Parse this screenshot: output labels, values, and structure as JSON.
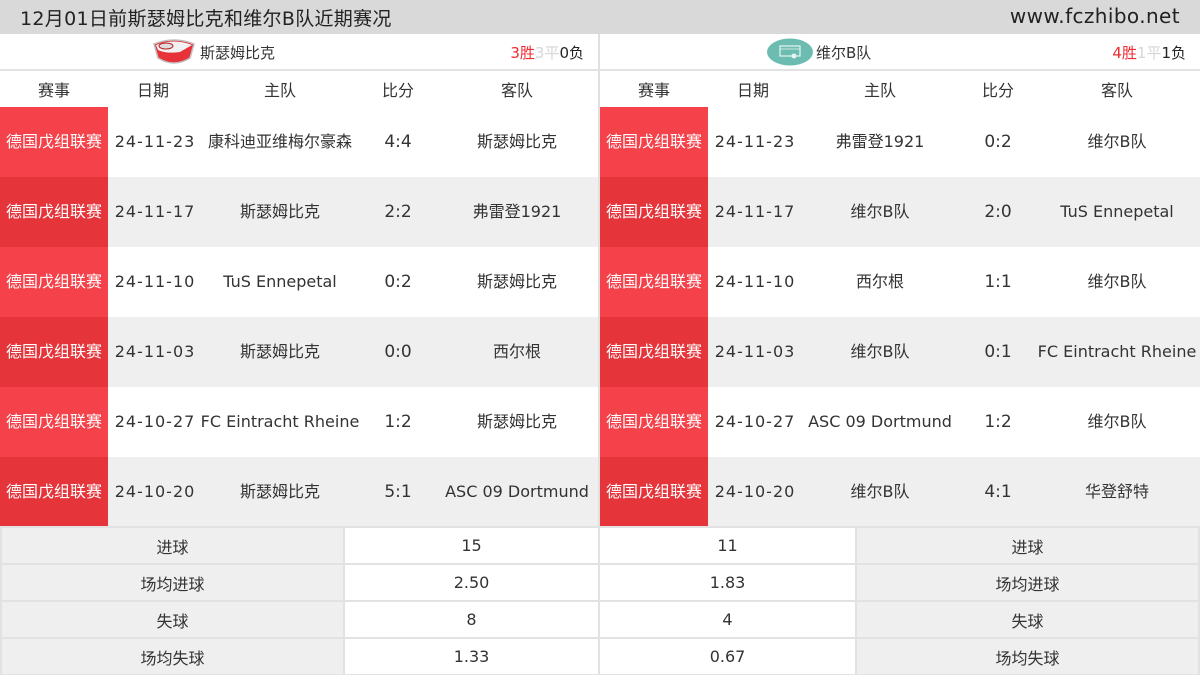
{
  "header": {
    "title": "12月01日前斯瑟姆比克和维尔B队近期赛况",
    "site": "www.fczhibo.net"
  },
  "columns": [
    "赛事",
    "日期",
    "主队",
    "比分",
    "客队"
  ],
  "colors": {
    "accent_red": "#ee2c33",
    "league_odd": "#f5414a",
    "league_even": "#e5343a",
    "row_even_bg": "#efefef",
    "topbar_bg": "#d9d9d9"
  },
  "left": {
    "team": "斯瑟姆比克",
    "logo_icon": "red-white-shield-crest",
    "record": {
      "win": "3胜",
      "draw": "3平",
      "loss": "0负"
    },
    "matches": [
      {
        "league": "德国戊组联赛",
        "date": "24-11-23",
        "home": "康科迪亚维梅尔豪森",
        "score": "4:4",
        "away": "斯瑟姆比克"
      },
      {
        "league": "德国戊组联赛",
        "date": "24-11-17",
        "home": "斯瑟姆比克",
        "score": "2:2",
        "away": "弗雷登1921"
      },
      {
        "league": "德国戊组联赛",
        "date": "24-11-10",
        "home": "TuS Ennepetal",
        "score": "0:2",
        "away": "斯瑟姆比克"
      },
      {
        "league": "德国戊组联赛",
        "date": "24-11-03",
        "home": "斯瑟姆比克",
        "score": "0:0",
        "away": "西尔根"
      },
      {
        "league": "德国戊组联赛",
        "date": "24-10-27",
        "home": "FC Eintracht Rheine",
        "score": "1:2",
        "away": "斯瑟姆比克"
      },
      {
        "league": "德国戊组联赛",
        "date": "24-10-20",
        "home": "斯瑟姆比克",
        "score": "5:1",
        "away": "ASC 09 Dortmund"
      }
    ],
    "stats": [
      {
        "label": "进球",
        "value": "15"
      },
      {
        "label": "场均进球",
        "value": "2.50"
      },
      {
        "label": "失球",
        "value": "8"
      },
      {
        "label": "场均失球",
        "value": "1.33"
      }
    ]
  },
  "right": {
    "team": "维尔B队",
    "logo_icon": "teal-placeholder-badge",
    "record": {
      "win": "4胜",
      "draw": "1平",
      "loss": "1负"
    },
    "matches": [
      {
        "league": "德国戊组联赛",
        "date": "24-11-23",
        "home": "弗雷登1921",
        "score": "0:2",
        "away": "维尔B队"
      },
      {
        "league": "德国戊组联赛",
        "date": "24-11-17",
        "home": "维尔B队",
        "score": "2:0",
        "away": "TuS Ennepetal"
      },
      {
        "league": "德国戊组联赛",
        "date": "24-11-10",
        "home": "西尔根",
        "score": "1:1",
        "away": "维尔B队"
      },
      {
        "league": "德国戊组联赛",
        "date": "24-11-03",
        "home": "维尔B队",
        "score": "0:1",
        "away": "FC Eintracht Rheine"
      },
      {
        "league": "德国戊组联赛",
        "date": "24-10-27",
        "home": "ASC 09 Dortmund",
        "score": "1:2",
        "away": "维尔B队"
      },
      {
        "league": "德国戊组联赛",
        "date": "24-10-20",
        "home": "维尔B队",
        "score": "4:1",
        "away": "华登舒特"
      }
    ],
    "stats": [
      {
        "label": "进球",
        "value": "11"
      },
      {
        "label": "场均进球",
        "value": "1.83"
      },
      {
        "label": "失球",
        "value": "4"
      },
      {
        "label": "场均失球",
        "value": "0.67"
      }
    ]
  }
}
